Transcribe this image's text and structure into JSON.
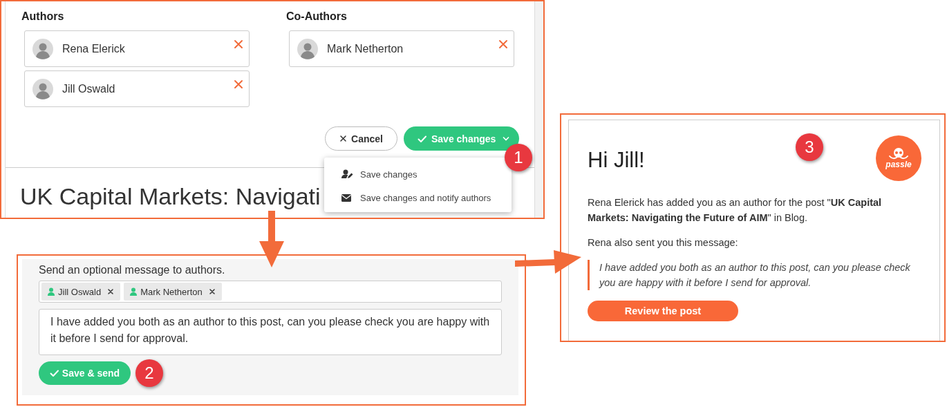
{
  "editor": {
    "authors_label": "Authors",
    "authors": [
      {
        "name": "Rena Elerick"
      },
      {
        "name": "Jill Oswald"
      }
    ],
    "coauthors_label": "Co-Authors",
    "coauthors": [
      {
        "name": "Mark Netherton"
      }
    ],
    "cancel_button": "Cancel",
    "save_button": "Save changes",
    "post_title": "UK Capital Markets: Navigati",
    "menu": [
      {
        "label": "Save changes",
        "kind": "person"
      },
      {
        "label": "Save changes and notify authors",
        "kind": "mail"
      }
    ]
  },
  "message_form": {
    "label": "Send an optional message to authors.",
    "recipients": [
      {
        "name": "Jill Oswald"
      },
      {
        "name": "Mark Netherton"
      }
    ],
    "message": "I have added you both as an author to this post, can you please check you are happy with it before I send for approval.",
    "send_button": "Save & send"
  },
  "email": {
    "greeting": "Hi Jill!",
    "logo": "passle",
    "body": "Rena Elerick has added you as an author for the post \"**UK Capital Markets: Navigating the Future of AIM**\" in Blog.",
    "intro": "Rena also sent you this message:",
    "quote": "I have added you both as an author to this post, can you please check you are happy with it before I send for approval.",
    "button": "Review the post"
  },
  "callouts": [
    {
      "number": "1"
    },
    {
      "number": "2"
    },
    {
      "number": "3"
    }
  ]
}
